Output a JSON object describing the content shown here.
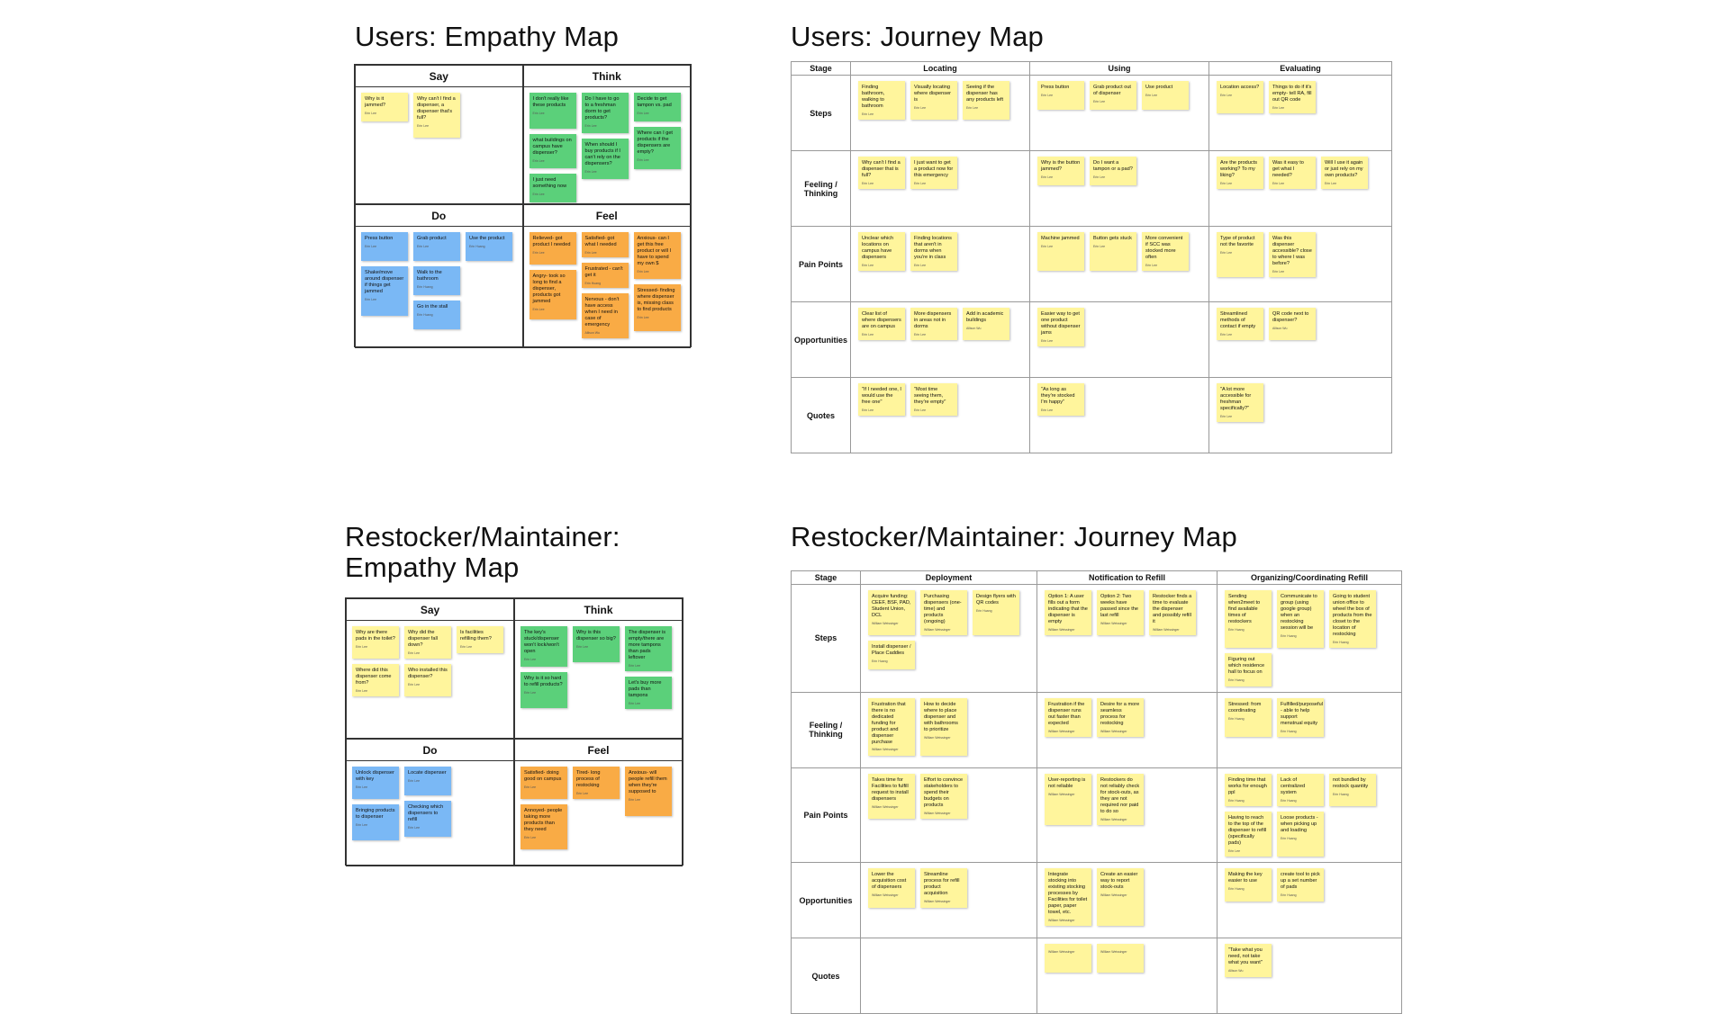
{
  "colors": {
    "yellow": "#fff59c",
    "green": "#5bd07a",
    "blue": "#7ab8f5",
    "orange": "#f9ab45"
  },
  "users_empathy": {
    "title": "Users: Empathy Map",
    "say": {
      "label": "Say",
      "notes": [
        {
          "text": "Why is it jammed?",
          "author": "Erin Lee"
        },
        {
          "text": "Why can't I find a dispenser, a dispenser that's full?",
          "author": "Erin Lee"
        }
      ]
    },
    "think": {
      "label": "Think",
      "col1": [
        {
          "text": "I don't really like these products",
          "author": "Erin Lee"
        },
        {
          "text": "what buildings on campus have dispenser?",
          "author": "Erin Lee"
        },
        {
          "text": "I just need something now",
          "author": "Erin Lee"
        }
      ],
      "col2": [
        {
          "text": "Do I have to go to a freshman dorm to get products?",
          "author": "Erin Lee"
        },
        {
          "text": "When should I buy products if I can't rely on the dispensers?",
          "author": "Erin Lee"
        }
      ],
      "col3": [
        {
          "text": "Decide to get tampon vs. pad",
          "author": "Erin Lee"
        },
        {
          "text": "Where can I get products if the dispensers are empty?",
          "author": "Erin Lee"
        }
      ]
    },
    "do": {
      "label": "Do",
      "col1": [
        {
          "text": "Press button",
          "author": "Erin Lee"
        },
        {
          "text": "Shake/move around dispenser if things get jammed",
          "author": "Erin Lee"
        }
      ],
      "col2": [
        {
          "text": "Grab product",
          "author": "Erin Lee"
        },
        {
          "text": "Walk to the bathroom",
          "author": "Erin Huang"
        },
        {
          "text": "Go in the stall",
          "author": "Erin Huang"
        }
      ],
      "col3": [
        {
          "text": "Use the product",
          "author": "Erin Huang"
        }
      ]
    },
    "feel": {
      "label": "Feel",
      "col1": [
        {
          "text": "Relieved- got product I needed",
          "author": "Erin Lee"
        },
        {
          "text": "Angry- took so long to find a dispenser, products got jammed",
          "author": "Erin Lee"
        }
      ],
      "col2": [
        {
          "text": "Satisfied- got what I needed",
          "author": "Erin Lee"
        },
        {
          "text": "Frustrated - can't get it",
          "author": "Erin Huang"
        },
        {
          "text": "Nervous - don't have access when I need in case of emergency",
          "author": "Allison Wu"
        }
      ],
      "col3": [
        {
          "text": "Anxious- can I get this free product or will I have to spend my own $",
          "author": "Erin Lee"
        },
        {
          "text": "Stressed- finding where dispenser is, missing class to find products",
          "author": "Erin Lee"
        }
      ]
    }
  },
  "users_journey": {
    "title": "Users: Journey Map",
    "stage_label": "Stage",
    "stages": [
      "Locating",
      "Using",
      "Evaluating"
    ],
    "rows": [
      {
        "label": "Steps",
        "cells": [
          [
            {
              "text": "Finding bathroom, walking to bathroom",
              "author": "Erin Lee"
            },
            {
              "text": "Visually locating where dispenser is",
              "author": "Erin Lee"
            },
            {
              "text": "Seeing if the dispenser has any products left",
              "author": "Erin Lee"
            }
          ],
          [
            {
              "text": "Press button",
              "author": "Erin Lee"
            },
            {
              "text": "Grab product out of dispenser",
              "author": "Erin Lee"
            },
            {
              "text": "Use product",
              "author": "Erin Lee"
            }
          ],
          [
            {
              "text": "Location access?",
              "author": "Erin Lee"
            },
            {
              "text": "Things to do if it's empty- tell RA, fill out QR code",
              "author": "Erin Lee"
            }
          ]
        ]
      },
      {
        "label": "Feeling / Thinking",
        "cells": [
          [
            {
              "text": "Why can't I find a dispenser that is full?",
              "author": "Erin Lee"
            },
            {
              "text": "I just want to get a product now for this emergency",
              "author": "Erin Lee"
            }
          ],
          [
            {
              "text": "Why is the button jammed?",
              "author": "Erin Lee"
            },
            {
              "text": "Do I want a tampon or a pad?",
              "author": "Erin Lee"
            }
          ],
          [
            {
              "text": "Are the products working? To my liking?",
              "author": "Erin Lee"
            },
            {
              "text": "Was it easy to get what I needed?",
              "author": "Erin Lee"
            },
            {
              "text": "Will I use it again or just rely on my own products?",
              "author": "Erin Lee"
            }
          ]
        ]
      },
      {
        "label": "Pain Points",
        "cells": [
          [
            {
              "text": "Unclear which locations on campus have dispensers",
              "author": "Erin Lee"
            },
            {
              "text": "Finding locations that aren't in dorms when you're in class",
              "author": "Erin Lee"
            }
          ],
          [
            {
              "text": "Machine jammed",
              "author": "Erin Lee"
            },
            {
              "text": "Button gets stuck",
              "author": "Erin Lee"
            },
            {
              "text": "More convenient if SCC was stocked more often",
              "author": "Erin Lee"
            }
          ],
          [
            {
              "text": "Type of product not the favorite",
              "author": "Erin Lee"
            },
            {
              "text": "Was this dispenser accessible? close to where I was before?",
              "author": "Erin Lee"
            }
          ]
        ]
      },
      {
        "label": "Opportunities",
        "cells": [
          [
            {
              "text": "Clear list of where dispensers are on campus",
              "author": "Erin Lee"
            },
            {
              "text": "More dispensers in areas not in dorms",
              "author": "Erin Lee"
            },
            {
              "text": "Add in academic buildings",
              "author": "Allison Wu"
            }
          ],
          [
            {
              "text": "Easier way to get one product without dispenser jams",
              "author": "Erin Lee"
            }
          ],
          [
            {
              "text": "Streamlined methods of contact if empty",
              "author": "Erin Lee"
            },
            {
              "text": "QR code next to dispenser?",
              "author": "Allison Wu"
            }
          ]
        ]
      },
      {
        "label": "Quotes",
        "cells": [
          [
            {
              "text": "\"If I needed one, I would use the free one\"",
              "author": "Erin Lee"
            },
            {
              "text": "\"Most time seeing them, they're empty\"",
              "author": "Erin Lee"
            }
          ],
          [
            {
              "text": "\"As long as they're stocked I'm happy\"",
              "author": "Erin Lee"
            }
          ],
          [
            {
              "text": "\"A lot more accessible for freshman specifically?\"",
              "author": "Erin Lee"
            }
          ]
        ]
      }
    ]
  },
  "rm_empathy": {
    "title_line1": "Restocker/Maintainer:",
    "title_line2": "Empathy Map",
    "say": {
      "label": "Say",
      "col1": [
        {
          "text": "Why are there pads in the toilet?",
          "author": "Erin Lee"
        },
        {
          "text": "Where did this dispenser come from?",
          "author": "Erin Lee"
        }
      ],
      "col2": [
        {
          "text": "Why did the dispenser fall down?",
          "author": "Erin Lee"
        },
        {
          "text": "Who installed this dispenser?",
          "author": "Erin Lee"
        }
      ],
      "col3": [
        {
          "text": "Is facilities refilling them?",
          "author": "Erin Lee"
        }
      ]
    },
    "think": {
      "label": "Think",
      "col1": [
        {
          "text": "The key's stuck/dispenser won't lock/won't open",
          "author": "Erin Lee"
        },
        {
          "text": "Why is it so hard to refill products?",
          "author": "Erin Lee"
        }
      ],
      "col2": [
        {
          "text": "Why is this dispenser so big?",
          "author": "Erin Lee"
        }
      ],
      "col3": [
        {
          "text": "The dispenser is empty/there are more tampons than pads leftover",
          "author": "Erin Lee"
        },
        {
          "text": "Let's buy more pads than tampons",
          "author": "Erin Lee"
        }
      ]
    },
    "do": {
      "label": "Do",
      "col1": [
        {
          "text": "Unlock dispenser with key",
          "author": "Erin Lee"
        },
        {
          "text": "Bringing products to dispenser",
          "author": "Erin Lee"
        }
      ],
      "col2": [
        {
          "text": "Locate dispenser",
          "author": "Erin Lee"
        },
        {
          "text": "Checking which dispensers to refill",
          "author": "Erin Lee"
        }
      ]
    },
    "feel": {
      "label": "Feel",
      "col1": [
        {
          "text": "Satisfied- doing good on campus",
          "author": "Erin Lee"
        },
        {
          "text": "Annoyed- people taking more products than they need",
          "author": "Erin Lee"
        }
      ],
      "col2": [
        {
          "text": "Tired- long process of restocking",
          "author": "Erin Lee"
        }
      ],
      "col3": [
        {
          "text": "Anxious- will people refill them when they're supposed to",
          "author": "Erin Lee"
        }
      ]
    }
  },
  "rm_journey": {
    "title": "Restocker/Maintainer: Journey Map",
    "stage_label": "Stage",
    "stages": [
      "Deployment",
      "Notification to Refill",
      "Organizing/Coordinating Refill"
    ],
    "rows": [
      {
        "label": "Steps",
        "cells": [
          [
            {
              "text": "Acquire funding: CEEF, BSF, PAD, Student Union, DCL",
              "author": "William Weissinger"
            },
            {
              "text": "Purchasing dispensers (one-time) and products (ongoing)",
              "author": "William Weissinger"
            },
            {
              "text": "Design flyers with QR codes",
              "author": "Erin Huang"
            },
            {
              "text": "Install dispenser / Place Caddies",
              "author": "Erin Huang"
            }
          ],
          [
            {
              "text": "Option 1: A user fills out a form indicating that the dispenser is empty",
              "author": "William Weissinger"
            },
            {
              "text": "Option 2: Two weeks have passed since the last refill",
              "author": "William Weissinger"
            },
            {
              "text": "Restocker finds a time to evaluate the dispenser and possibly refill it",
              "author": "William Weissinger"
            }
          ],
          [
            {
              "text": "Sending when2meet to find available times of restockers",
              "author": "Erin Huang"
            },
            {
              "text": "Communicate to group (using google group) when an restocking session will be",
              "author": "Erin Huang"
            },
            {
              "text": "Going to student union office to wheel the box of products from the closet to the location of restocking",
              "author": "Erin Huang"
            },
            {
              "text": "Figuring out which residence hall to focus on",
              "author": "Erin Huang"
            }
          ]
        ]
      },
      {
        "label": "Feeling / Thinking",
        "cells": [
          [
            {
              "text": "Frustration that there is no dedicated funding for product and dispenser purchase",
              "author": "William Weissinger"
            },
            {
              "text": "How to decide where to place dispenser and with bathrooms to prioritize",
              "author": "William Weissinger"
            }
          ],
          [
            {
              "text": "Frustration if the dispenser runs out faster than expected",
              "author": "William Weissinger"
            },
            {
              "text": "Desire for a more seamless process for restocking",
              "author": "William Weissinger"
            }
          ],
          [
            {
              "text": "Stressed: from coordinating",
              "author": "Erin Huang"
            },
            {
              "text": "Fulfilled/purposeful - able to help support menstrual equity",
              "author": "Erin Huang"
            }
          ]
        ]
      },
      {
        "label": "Pain Points",
        "cells": [
          [
            {
              "text": "Takes time for Facilities to fulfill request to install dispensers",
              "author": "William Weissinger"
            },
            {
              "text": "Effort to convince stakeholders to spend their budgets on products",
              "author": "William Weissinger"
            }
          ],
          [
            {
              "text": "User-reporting is not reliable",
              "author": "William Weissinger"
            },
            {
              "text": "Restockers do not reliably check for stock-outs, as they are not required nor paid to do so",
              "author": "William Weissinger"
            }
          ],
          [
            {
              "text": "Finding time that works for enough ppl",
              "author": "Erin Huang"
            },
            {
              "text": "Lack of centralized system",
              "author": "Erin Huang"
            },
            {
              "text": "not bundled by restock quantity",
              "author": "Erin Huang"
            },
            {
              "text": "Having to reach to the top of the dispenser to refill (specifically pads)",
              "author": "Erin Lee"
            },
            {
              "text": "Loose products - when picking up and loading",
              "author": "Erin Huang"
            }
          ]
        ]
      },
      {
        "label": "Opportunities",
        "cells": [
          [
            {
              "text": "Lower the acquisition cost of dispensers",
              "author": "William Weissinger"
            },
            {
              "text": "Streamline process for refill product acquisition",
              "author": "William Weissinger"
            }
          ],
          [
            {
              "text": "Integrate stocking into existing stocking processes by Facilities for toilet paper, paper towel, etc.",
              "author": "William Weissinger"
            },
            {
              "text": "Create an easier way to report stock-outs",
              "author": "William Weissinger"
            }
          ],
          [
            {
              "text": "Making the key easier to use",
              "author": "Erin Huang"
            },
            {
              "text": "create tool to pick up a set number of pads",
              "author": "Erin Huang"
            }
          ]
        ]
      },
      {
        "label": "Quotes",
        "cells": [
          [],
          [
            {
              "text": "",
              "author": "William Weissinger"
            },
            {
              "text": "",
              "author": "William Weissinger"
            }
          ],
          [
            {
              "text": "\"Take what you need, not take what you want\"",
              "author": "Allison Wu"
            }
          ]
        ]
      }
    ]
  }
}
